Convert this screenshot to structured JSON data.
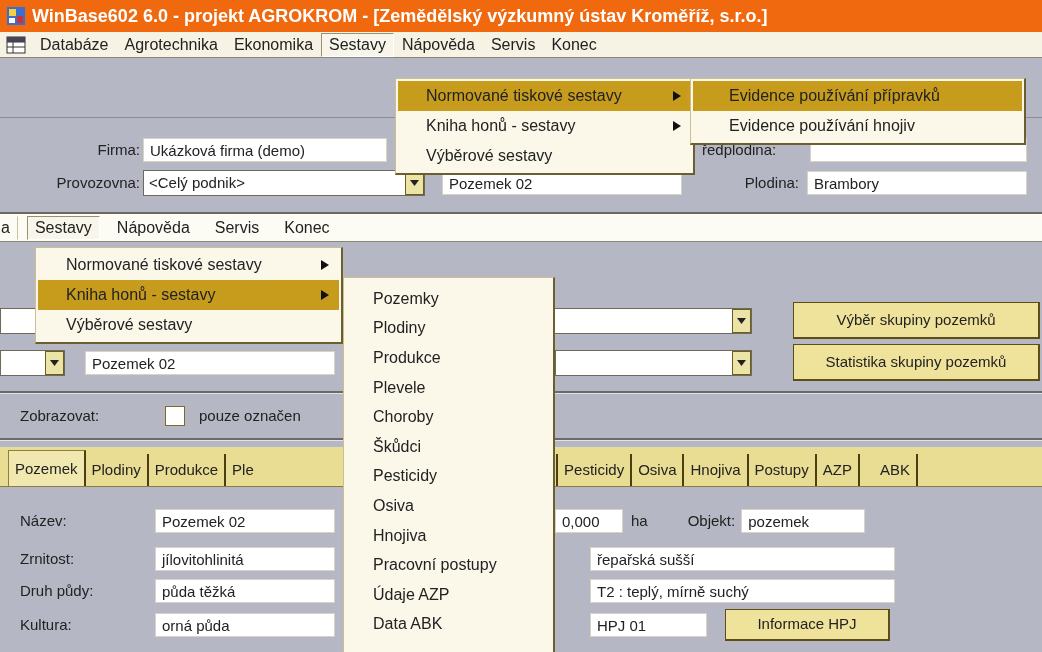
{
  "top_window": {
    "title": "WinBase602 6.0 - projekt AGROKROM - [Zemědělský výzkumný ústav Kroměříž, s.r.o.]",
    "menu": [
      {
        "label": "Databáze",
        "selected": false
      },
      {
        "label": "Agrotechnika",
        "selected": false
      },
      {
        "label": "Ekonomika",
        "selected": false
      },
      {
        "label": "Sestavy",
        "selected": true
      },
      {
        "label": "Nápověda",
        "selected": false
      },
      {
        "label": "Servis",
        "selected": false
      },
      {
        "label": "Konec",
        "selected": false
      }
    ],
    "sestavy_menu": [
      {
        "label": "Normované tiskové sestavy",
        "submenu": true,
        "selected": true
      },
      {
        "label": "Kniha honů - sestavy",
        "submenu": true,
        "selected": false
      },
      {
        "label": "Výběrové sestavy",
        "submenu": false,
        "selected": false
      }
    ],
    "submenu": [
      {
        "label": "Evidence používání přípravků",
        "selected": true
      },
      {
        "label": "Evidence používání hnojiv",
        "selected": false
      }
    ],
    "form": {
      "firma_label": "Firma:",
      "firma_value": "Ukázková firma (demo)",
      "predplodina_label": "ředplodina:",
      "provozovna_label": "Provozovna:",
      "provozovna_value": "<Celý podnik>",
      "pozemek_value": "Pozemek 02",
      "plodina_label": "Plodina:",
      "plodina_value": "Brambory"
    }
  },
  "bottom_window": {
    "menu": [
      {
        "label": "a",
        "selected": false
      },
      {
        "label": "Sestavy",
        "selected": true
      },
      {
        "label": "Nápověda",
        "selected": false
      },
      {
        "label": "Servis",
        "selected": false
      },
      {
        "label": "Konec",
        "selected": false
      }
    ],
    "sestavy_menu": [
      {
        "label": "Normované tiskové sestavy",
        "submenu": true,
        "selected": false
      },
      {
        "label": "Kniha honů - sestavy",
        "submenu": true,
        "selected": true
      },
      {
        "label": "Výběrové sestavy",
        "submenu": false,
        "selected": false
      }
    ],
    "submenu": [
      {
        "label": "Pozemky",
        "selected": false
      },
      {
        "label": "Plodiny",
        "selected": false
      },
      {
        "label": "Produkce",
        "selected": false
      },
      {
        "label": "Plevele",
        "selected": false
      },
      {
        "label": "Choroby",
        "selected": false
      },
      {
        "label": "Škůdci",
        "selected": false
      },
      {
        "label": "Pesticidy",
        "selected": false
      },
      {
        "label": "Osiva",
        "selected": false
      },
      {
        "label": "Hnojiva",
        "selected": false
      },
      {
        "label": "Pracovní postupy",
        "selected": false
      },
      {
        "label": "Údaje AZP",
        "selected": false
      },
      {
        "label": "Data ABK",
        "selected": false
      }
    ],
    "pozemek_value": "Pozemek 02",
    "buttons": [
      "Výběr skupiny pozemků",
      "Statistika skupiny pozemků"
    ],
    "zobrazovat_label": "Zobrazovat:",
    "checkbox": {
      "label": "pouze označen",
      "checked": false
    },
    "tabs": [
      {
        "label": "Pozemek",
        "selected": true
      },
      {
        "label": "Plodiny",
        "selected": false
      },
      {
        "label": "Produkce",
        "selected": false
      },
      {
        "label": "Ple",
        "selected": false
      },
      {
        "label": "Pesticidy",
        "selected": false
      },
      {
        "label": "Osiva",
        "selected": false
      },
      {
        "label": "Hnojiva",
        "selected": false
      },
      {
        "label": "Postupy",
        "selected": false
      },
      {
        "label": "AZP",
        "selected": false
      },
      {
        "label": "ABK",
        "selected": false
      }
    ],
    "form": {
      "nazev_label": "Název:",
      "nazev_value": "Pozemek 02",
      "area_value": "0,000",
      "area_unit": "ha",
      "objekt_label": "Objekt:",
      "objekt_value": "pozemek",
      "zrnitost_label": "Zrnitost:",
      "zrnitost_value": "jílovitohlinitá",
      "zrnitost_right": "řepařská sušší",
      "druh_label": "Druh půdy:",
      "druh_value": "půda těžká",
      "druh_right": "T2 : teplý, mírně suchý",
      "kultura_label": "Kultura:",
      "kultura_value": "orná půda",
      "hpj_value": "HPJ 01",
      "hpj_button": "Informace HPJ"
    }
  }
}
